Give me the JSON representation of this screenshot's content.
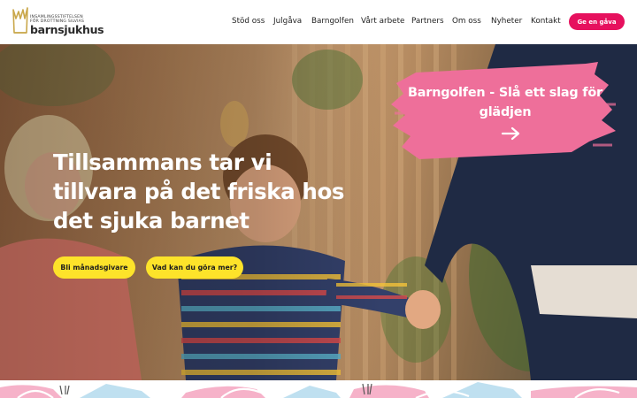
{
  "logo": {
    "line1": "INSAMLINGSSTIFTELSEN",
    "line2": "FÖR DROTTNING SILVIAS",
    "wordmark": "barnsjukhus",
    "icon": "crown-icon"
  },
  "nav": {
    "items": [
      "Stöd oss",
      "Julgåva",
      "Barngolfen",
      "Vårt arbete",
      "Partners",
      "Om oss",
      "Nyheter",
      "Kontakt"
    ],
    "give_button": "Ge en gåva"
  },
  "hero": {
    "title": "Tillsammans tar vi tillvara på det friska hos det sjuka barnet",
    "cta_primary": "Bli månadsgivare",
    "cta_secondary": "Vad kan du göra mer?",
    "promo_text": "Barngolfen - Slå ett slag för glädjen",
    "promo_icon": "arrow-right-icon"
  },
  "colors": {
    "accent_pink": "#e6115e",
    "promo_pink": "#ee6f9a",
    "cta_yellow": "#fde32a"
  }
}
